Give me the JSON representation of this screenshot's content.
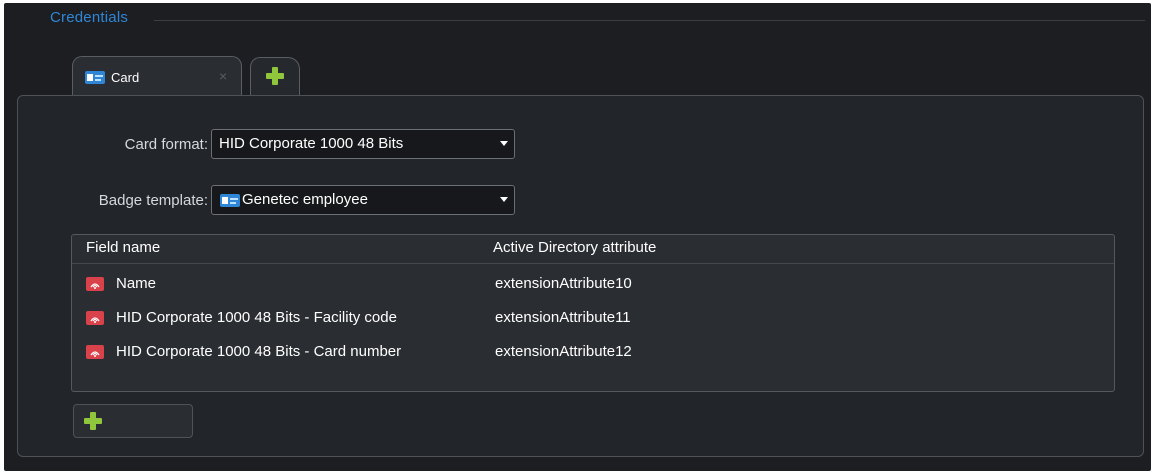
{
  "section": {
    "title": "Credentials"
  },
  "tabs": [
    {
      "label": "Card",
      "icon": "card-icon",
      "close_glyph": "×"
    }
  ],
  "add_tab": {
    "icon": "plus-icon"
  },
  "form": {
    "card_format": {
      "label": "Card format:",
      "value": "HID Corporate 1000 48 Bits"
    },
    "badge_template": {
      "label": "Badge template:",
      "value": "Genetec employee",
      "icon": "badge-icon"
    }
  },
  "grid": {
    "columns": [
      "Field name",
      "Active Directory attribute"
    ],
    "rows": [
      {
        "field": "Name",
        "attribute": "extensionAttribute10",
        "icon": "rfid-icon"
      },
      {
        "field": "HID Corporate 1000 48 Bits - Facility code",
        "attribute": "extensionAttribute11",
        "icon": "rfid-icon"
      },
      {
        "field": "HID Corporate 1000 48 Bits - Card number",
        "attribute": "extensionAttribute12",
        "icon": "rfid-icon"
      }
    ]
  },
  "add_button": {
    "icon": "plus-icon"
  },
  "colors": {
    "accent": "#2f86d6",
    "plus": "#8fc63b",
    "background": "#1c1e21",
    "rfid": "#d9424a"
  }
}
